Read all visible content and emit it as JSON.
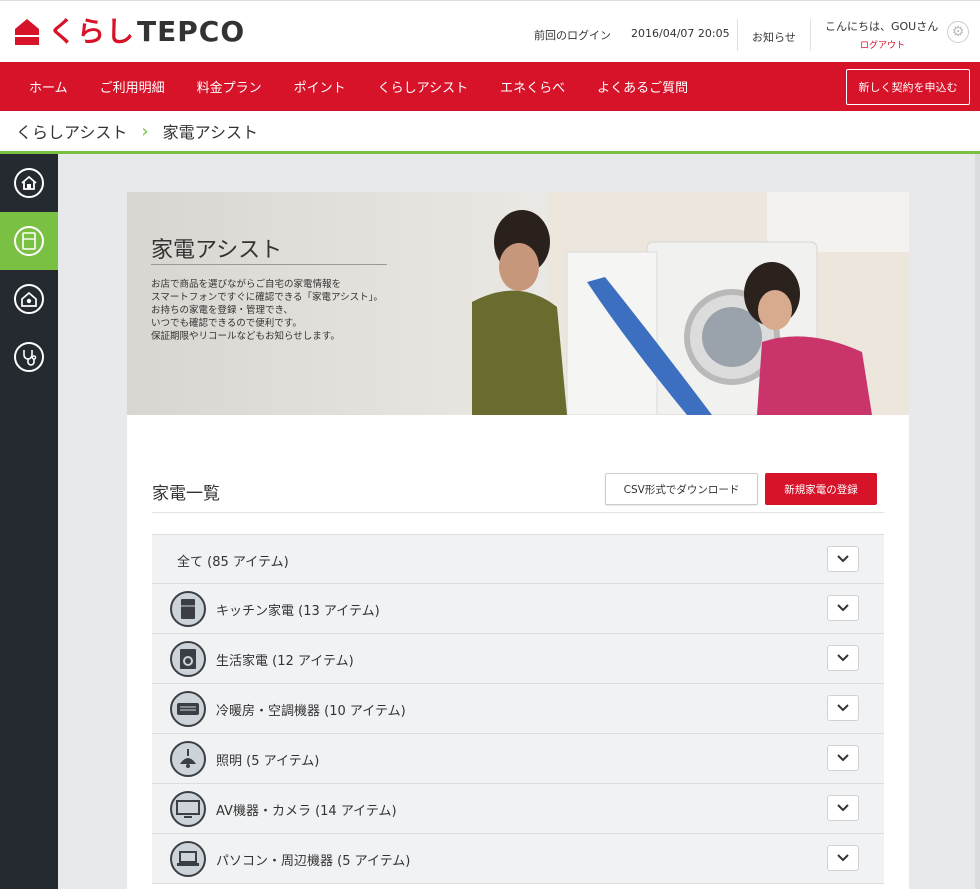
{
  "header": {
    "logo_kurashi": "くらし",
    "logo_tepco": "TEPCO",
    "last_login_label": "前回のログイン",
    "last_login_time": "2016/04/07 20:05",
    "notice": "お知らせ",
    "greeting": "こんにちは、GOUさん",
    "logout": "ログアウト"
  },
  "nav": {
    "items": [
      "ホーム",
      "ご利用明細",
      "料金プラン",
      "ポイント",
      "くらしアシスト",
      "エネくらべ",
      "よくあるご質問"
    ],
    "cta": "新しく契約を申込む"
  },
  "breadcrumb": {
    "parent": "くらしアシスト",
    "current": "家電アシスト"
  },
  "hero": {
    "title": "家電アシスト",
    "description": "お店で商品を選びながらご自宅の家電情報を\nスマートフォンですぐに確認できる「家電アシスト」。\nお持ちの家電を登録・管理でき、\nいつでも確認できるので便利です。\n保証期限やリコールなどもお知らせします。"
  },
  "list_section": {
    "title": "家電一覧",
    "csv_button": "CSV形式でダウンロード",
    "new_button": "新規家電の登録",
    "rows": [
      "全て (85 アイテム)",
      "キッチン家電 (13 アイテム)",
      "生活家電 (12 アイテム)",
      "冷暖房・空調機器 (10 アイテム)",
      "照明 (5 アイテム)",
      "AV機器・カメラ (14 アイテム)",
      "パソコン・周辺機器 (5 アイテム)"
    ]
  },
  "colors": {
    "brand_red": "#d7132a",
    "accent_green": "#7ac143",
    "sidebar_dark": "#252a31"
  }
}
